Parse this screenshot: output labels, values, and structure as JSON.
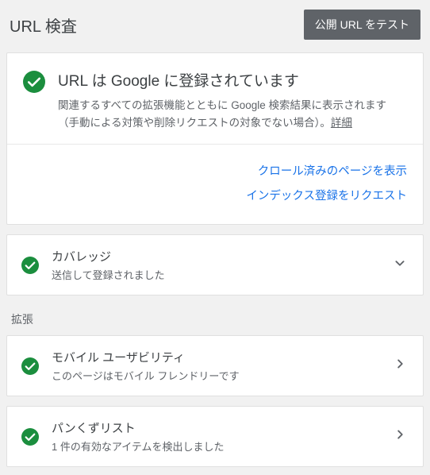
{
  "header": {
    "title": "URL 検査",
    "test_button": "公開 URL をテスト"
  },
  "main_status": {
    "title": "URL は Google に登録されています",
    "description": "関連するすべての拡張機能とともに Google 検索結果に表示されます（手動による対策や削除リクエストの対象でない場合）。",
    "details_link": "詳細"
  },
  "actions": {
    "show_crawled": "クロール済みのページを表示",
    "request_indexing": "インデックス登録をリクエスト"
  },
  "coverage": {
    "title": "カバレッジ",
    "subtitle": "送信して登録されました"
  },
  "enhancements_label": "拡張",
  "enhancements": [
    {
      "title": "モバイル ユーザビリティ",
      "subtitle": "このページはモバイル フレンドリーです"
    },
    {
      "title": "パンくずリスト",
      "subtitle": "1 件の有効なアイテムを検出しました"
    }
  ]
}
